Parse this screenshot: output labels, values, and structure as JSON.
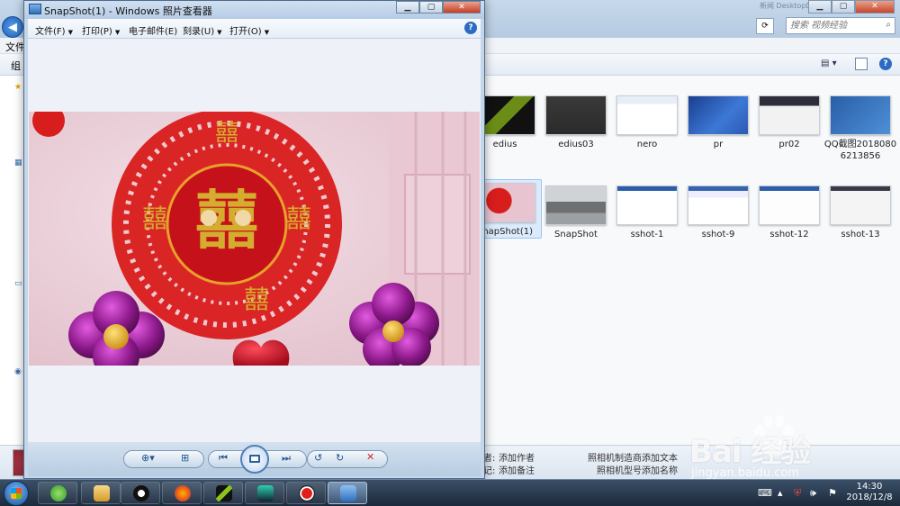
{
  "explorer": {
    "title_blurred": "新闻 DesktopDirect",
    "search_placeholder": "搜索 视频经验",
    "menu_label": "文件",
    "organize_label": "组",
    "thumbnails": [
      {
        "label": "edius",
        "selected": false
      },
      {
        "label": "edius03",
        "selected": false
      },
      {
        "label": "nero",
        "selected": false
      },
      {
        "label": "pr",
        "selected": false
      },
      {
        "label": "pr02",
        "selected": false
      },
      {
        "label": "QQ截图20180806213856",
        "selected": false
      },
      {
        "label": "SnapShot(1)",
        "selected": true
      },
      {
        "label": "SnapShot",
        "selected": false
      },
      {
        "label": "sshot-1",
        "selected": false
      },
      {
        "label": "sshot-9",
        "selected": false
      },
      {
        "label": "sshot-12",
        "selected": false
      },
      {
        "label": "sshot-13",
        "selected": false
      }
    ],
    "details": {
      "author_label": "者:",
      "author_value": "添加作者",
      "tags_label": "记:",
      "tags_value": "添加备注",
      "camera_maker_label": "照相机制造商:",
      "camera_maker_value": "添加文本",
      "camera_model_label": "照相机型号:",
      "camera_model_value": "添加名称"
    }
  },
  "viewer": {
    "title": "SnapShot(1) - Windows 照片查看器",
    "menu": [
      {
        "label": "文件(F)"
      },
      {
        "label": "打印(P)"
      },
      {
        "label": "电子邮件(E)"
      },
      {
        "label": "刻录(U)"
      },
      {
        "label": "打开(O)"
      }
    ],
    "help_icon": "?",
    "controls": {
      "zoom_icon": "zoom-icon",
      "fit_icon": "actual-size-icon",
      "prev_icon": "previous-icon",
      "slideshow_icon": "slideshow-icon",
      "next_icon": "next-icon",
      "rotate_ccw_icon": "rotate-left-icon",
      "rotate_cw_icon": "rotate-right-icon",
      "delete_icon": "delete-icon"
    }
  },
  "taskbar": {
    "time": "14:30",
    "date": "2018/12/8"
  },
  "watermark": {
    "text": "Bai 经验",
    "url": "jingyan.baidu.com"
  },
  "colors": {
    "viewer_frame": "#c3d6ea",
    "selection": "#dcebfc",
    "taskbar": "#1b2a3b",
    "paper_cut_red": "#d81d1d",
    "balloon_purple": "#8e1a8c"
  }
}
